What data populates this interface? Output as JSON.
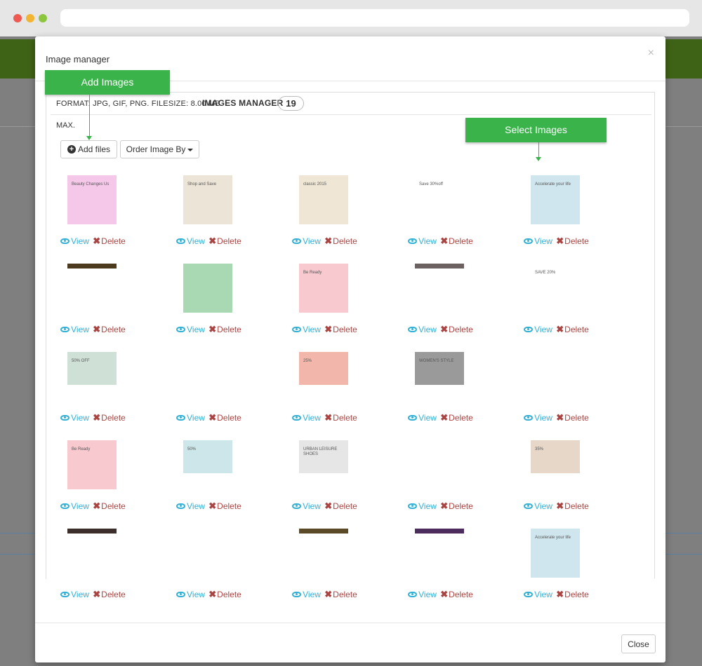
{
  "modal": {
    "title": "Image manager",
    "close_x": "×",
    "close_label": "Close"
  },
  "info": {
    "format_text": "FORMAT: JPG, GIF, PNG. FILESIZE: 8.00 MB",
    "title": "IMAGES MANAGER",
    "count": "19",
    "max_text": "MAX."
  },
  "toolbar": {
    "add_label": "Add files",
    "order_label": "Order Image By"
  },
  "callouts": {
    "add": "Add Images",
    "select": "Select Images"
  },
  "actions": {
    "view_label": "View",
    "delete_label": "Delete"
  },
  "images": [
    {
      "name": "beauty-banner",
      "kind": "full",
      "bg": "#f5c8ea",
      "text": "Beauty Changes Us"
    },
    {
      "name": "sofa-banner",
      "kind": "full",
      "bg": "#ece4d6",
      "text": "Shop and Save"
    },
    {
      "name": "classic-banner",
      "kind": "full",
      "bg": "#efe6d5",
      "text": "classic 2015"
    },
    {
      "name": "wallet-banner",
      "kind": "full",
      "bg": "#ffffff",
      "text": "Save 30%off"
    },
    {
      "name": "phone-banner",
      "kind": "full",
      "bg": "#cfe6ee",
      "text": "Accelerate your life"
    },
    {
      "name": "dark-strip-1",
      "kind": "strip",
      "bg": "#4c3a1e"
    },
    {
      "name": "heart-banner",
      "kind": "full",
      "bg": "#a9d9b2"
    },
    {
      "name": "be-ready-1",
      "kind": "full",
      "bg": "#f8c9cf",
      "text": "Be Ready"
    },
    {
      "name": "dark-strip-2",
      "kind": "strip",
      "bg": "#6b6161"
    },
    {
      "name": "family-banner",
      "kind": "full",
      "bg": "#ffffff",
      "text": "SAVE 20%"
    },
    {
      "name": "man-banner",
      "kind": "short",
      "bg": "#cfe0d6",
      "text": "50% OFF"
    },
    {
      "name": "tablet-banner",
      "kind": "short",
      "bg": "#ffffff"
    },
    {
      "name": "pink-25-banner",
      "kind": "short",
      "bg": "#f2b7aa",
      "text": "25%"
    },
    {
      "name": "women-style-banner",
      "kind": "short",
      "bg": "#9a9a9a",
      "text": "WOMEN'S STYLE"
    },
    {
      "name": "bag-banner",
      "kind": "short",
      "bg": "#ffffff"
    },
    {
      "name": "be-ready-2",
      "kind": "full",
      "bg": "#f8c9cf",
      "text": "Be Ready"
    },
    {
      "name": "teal-50-banner",
      "kind": "short",
      "bg": "#cde6e9",
      "text": "50%"
    },
    {
      "name": "shoes-banner",
      "kind": "short",
      "bg": "#e6e6e6",
      "text": "URBAN LEISURE SHOES"
    },
    {
      "name": "crocs-banner",
      "kind": "short",
      "bg": "#ffffff"
    },
    {
      "name": "beige-35-banner",
      "kind": "short",
      "bg": "#e6d7c8",
      "text": "35%"
    },
    {
      "name": "dark-strip-3",
      "kind": "strip",
      "bg": "#3c2f2b"
    },
    {
      "name": "sneaker-banner",
      "kind": "full",
      "bg": "#ffffff"
    },
    {
      "name": "dark-strip-4",
      "kind": "strip",
      "bg": "#5b4a28"
    },
    {
      "name": "purple-strip",
      "kind": "strip",
      "bg": "#4b2c5d"
    },
    {
      "name": "phone-banner-2",
      "kind": "full",
      "bg": "#cfe6ee",
      "text": "Accelerate your life"
    }
  ]
}
